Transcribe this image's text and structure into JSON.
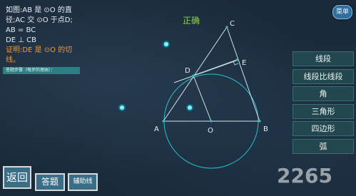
{
  "problem": {
    "lines": [
      "如图:AB 是 ⊙O 的直",
      "径;AC 交 ⊙O 于点D;",
      "AB = BC",
      "DE ⊥ CB"
    ],
    "prove": "证明:DE 是 ⊙O 的切线。"
  },
  "steps_label": "答题步骤（每步的理由）：",
  "status_text": "正确",
  "expand_button": "菜单",
  "menu": [
    {
      "label": "线段"
    },
    {
      "label": "线段比线段"
    },
    {
      "label": "角"
    },
    {
      "label": "三角形"
    },
    {
      "label": "四边形"
    },
    {
      "label": "弧"
    }
  ],
  "buttons": {
    "back": "返回",
    "answer": "答题",
    "aux_line": "辅助线"
  },
  "diagram": {
    "points": {
      "A": "A",
      "B": "B",
      "C": "C",
      "D": "D",
      "E": "E",
      "O": "O"
    }
  },
  "watermark": "2265",
  "colors": {
    "figure_line": "#cfe3ea",
    "circle": "#29c1c9",
    "glow_dot": "#00e5ff",
    "status": "#8fd14f",
    "prove_text": "#f29a3a"
  }
}
